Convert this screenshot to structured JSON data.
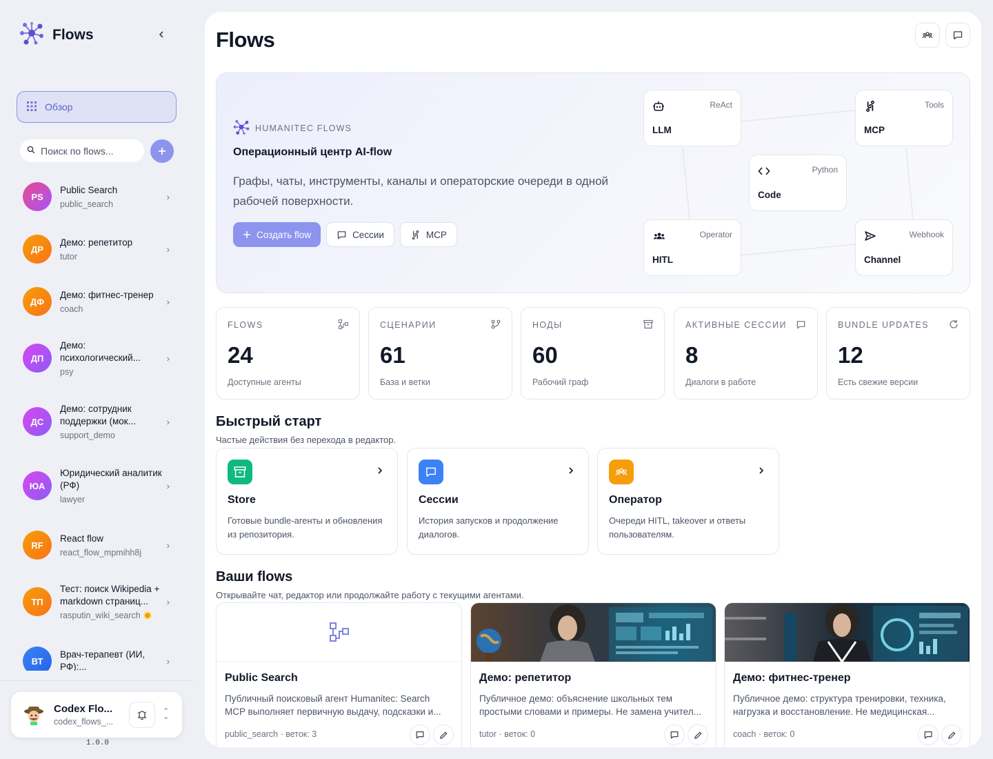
{
  "app": {
    "name": "Flows",
    "version": "1.0.0"
  },
  "sidebar": {
    "overview_label": "Обзор",
    "search_placeholder": "Поиск по flows...",
    "flows": [
      {
        "initials": "PS",
        "name": "Public Search",
        "slug": "public_search",
        "color": "#c44fcf"
      },
      {
        "initials": "ДР",
        "name": "Демо: репетитор",
        "slug": "tutor",
        "color": "#f97316"
      },
      {
        "initials": "ДФ",
        "name": "Демо: фитнес-тренер",
        "slug": "coach",
        "color": "#f97316"
      },
      {
        "initials": "ДП",
        "name": "Демо: психологический...",
        "slug": "psy",
        "color": "#b84fd8"
      },
      {
        "initials": "ДС",
        "name": "Демо: сотрудник поддержки (мок...",
        "slug": "support_demo",
        "color": "#b84fd8"
      },
      {
        "initials": "ЮА",
        "name": "Юридический аналитик (РФ)",
        "slug": "lawyer",
        "color": "#b84fd8"
      },
      {
        "initials": "RF",
        "name": "React flow",
        "slug": "react_flow_mpmihh8j",
        "color": "#f97316"
      },
      {
        "initials": "ТП",
        "name": "Тест: поиск Wikipedia + markdown страниц...",
        "slug": "rasputin_wiki_search",
        "color": "#f97316",
        "status_dot": true
      },
      {
        "initials": "ВТ",
        "name": "Врач-терапевт (ИИ, РФ):...",
        "slug": "",
        "color": "#3b82f6"
      }
    ],
    "user": {
      "name": "Codex Flo...",
      "email": "codex_flows_..."
    }
  },
  "header": {
    "title": "Flows"
  },
  "hero": {
    "brand": "HUMANITEC FLOWS",
    "title": "Операционный центр AI-flow",
    "description": "Графы, чаты, инструменты, каналы и операторские очереди в одной рабочей поверхности.",
    "create_label": "Создать flow",
    "sessions_label": "Сессии",
    "mcp_label": "MCP",
    "nodes": [
      {
        "name": "LLM",
        "tag": "ReAct",
        "icon": "robot-icon"
      },
      {
        "name": "MCP",
        "tag": "Tools",
        "icon": "plug-icon"
      },
      {
        "name": "Code",
        "tag": "Python",
        "icon": "code-icon"
      },
      {
        "name": "HITL",
        "tag": "Operator",
        "icon": "users-icon"
      },
      {
        "name": "Channel",
        "tag": "Webhook",
        "icon": "send-icon"
      }
    ]
  },
  "stats": [
    {
      "label": "FLOWS",
      "value": "24",
      "sub": "Доступные агенты",
      "icon": "workflow-icon"
    },
    {
      "label": "СЦЕНАРИИ",
      "value": "61",
      "sub": "База и ветки",
      "icon": "git-branch-icon"
    },
    {
      "label": "НОДЫ",
      "value": "60",
      "sub": "Рабочий граф",
      "icon": "archive-icon"
    },
    {
      "label": "АКТИВНЫЕ СЕССИИ",
      "value": "8",
      "sub": "Диалоги в работе",
      "icon": "chat-icon"
    },
    {
      "label": "BUNDLE UPDATES",
      "value": "12",
      "sub": "Есть свежие версии",
      "icon": "refresh-icon"
    }
  ],
  "quick_start": {
    "title": "Быстрый старт",
    "subtitle": "Частые действия без перехода в редактор.",
    "cards": [
      {
        "title": "Store",
        "desc": "Готовые bundle-агенты и обновления из репозитория.",
        "color": "#10b981",
        "icon": "archive-icon"
      },
      {
        "title": "Сессии",
        "desc": "История запусков и продолжение диалогов.",
        "color": "#3b82f6",
        "icon": "chat-icon"
      },
      {
        "title": "Оператор",
        "desc": "Очереди HITL, takeover и ответы пользователям.",
        "color": "#f59e0b",
        "icon": "users-icon"
      }
    ]
  },
  "your_flows": {
    "title": "Ваши flows",
    "subtitle": "Открывайте чат, редактор или продолжайте работу с текущими агентами.",
    "cards": [
      {
        "title": "Public Search",
        "desc": "Публичный поисковый агент Humanitec: Search MCP выполняет первичную выдачу, подсказки и...",
        "meta": "public_search · веток: 3",
        "thumb": "workflow-icon"
      },
      {
        "title": "Демо: репетитор",
        "desc": "Публичное демо: объяснение школьных тем простыми словами и примеры. Не замена учител...",
        "meta": "tutor · веток: 0",
        "thumb": "tutor-image"
      },
      {
        "title": "Демо: фитнес-тренер",
        "desc": "Публичное демо: структура тренировки, техника, нагрузка и восстановление. Не медицинская...",
        "meta": "coach · веток: 0",
        "thumb": "coach-image"
      }
    ]
  }
}
